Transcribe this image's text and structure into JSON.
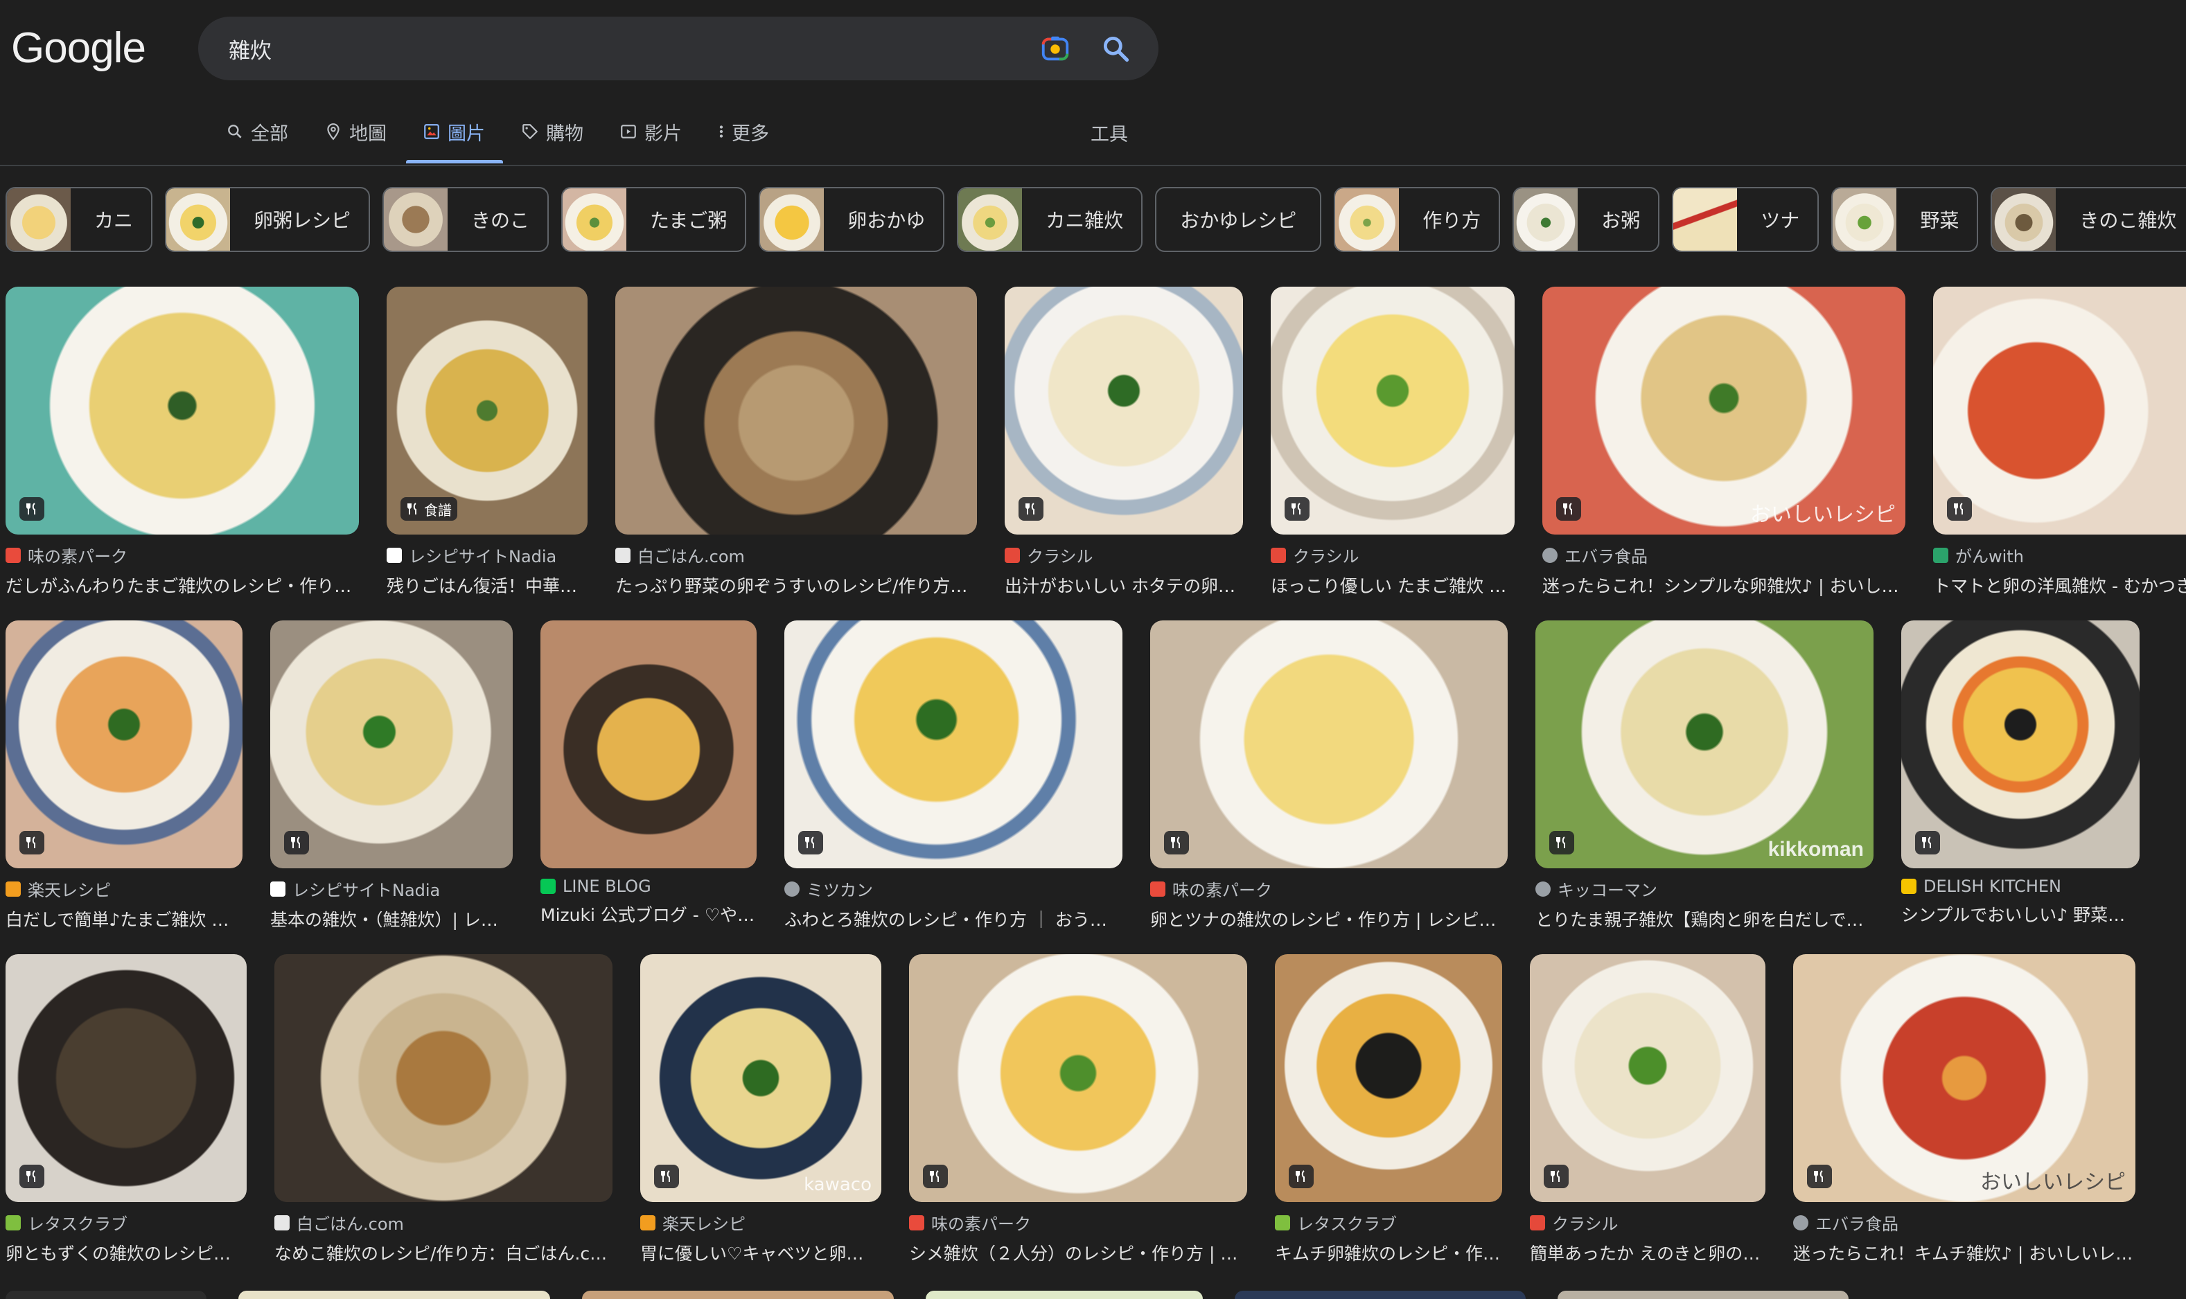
{
  "logo": "Google",
  "search": {
    "query": "雜炊"
  },
  "tabs": [
    {
      "label": "全部",
      "icon": "search-icon"
    },
    {
      "label": "地圖",
      "icon": "map-pin-icon"
    },
    {
      "label": "圖片",
      "icon": "image-icon",
      "active": true
    },
    {
      "label": "購物",
      "icon": "tag-icon"
    },
    {
      "label": "影片",
      "icon": "video-icon"
    },
    {
      "label": "更多",
      "icon": "more-vert-icon"
    }
  ],
  "tools": "工具",
  "chips": [
    "カニ",
    "卵粥レシピ",
    "きのこ",
    "たまご粥",
    "卵おかゆ",
    "カニ雑炊",
    "おかゆレシピ",
    "作り方",
    "お粥",
    "ツナ",
    "野菜",
    "きのこ雑炊"
  ],
  "results": {
    "row1": [
      {
        "source": "味の素パーク",
        "title": "だしがふんわりたまご雑炊のレシピ・作り…"
      },
      {
        "source": "レシピサイトNadia",
        "title": "残りごはん復活！中華…",
        "badge_text": "食譜"
      },
      {
        "source": "白ごはん.com",
        "title": "たっぷり野菜の卵ぞうすいのレシピ/作り方…"
      },
      {
        "source": "クラシル",
        "title": "出汁がおいしい ホタテの卵…"
      },
      {
        "source": "クラシル",
        "title": "ほっこり優しい たまご雑炊 …"
      },
      {
        "source": "エバラ食品",
        "title": "迷ったらこれ！シンプルな卵雑炊♪ | おいし…",
        "overlay": "おいしいレシピ"
      },
      {
        "source": "がんwith",
        "title": "トマトと卵の洋風雑炊 - むかつき"
      }
    ],
    "row2": [
      {
        "source": "楽天レシピ",
        "title": "白だしで簡単♪たまご雑炊 レ…"
      },
      {
        "source": "レシピサイトNadia",
        "title": "基本の雑炊・（鮭雑炊）| レ…"
      },
      {
        "source": "LINE BLOG",
        "title": "Mizuki 公式ブログ - ♡や…"
      },
      {
        "source": "ミツカン",
        "title": "ふわとろ雑炊のレシピ・作り方 ｜ おうち…"
      },
      {
        "source": "味の素パーク",
        "title": "卵とツナの雑炊のレシピ・作り方 | レシピ…"
      },
      {
        "source": "キッコーマン",
        "title": "とりたま親子雑炊【鶏肉と卵を白だしで…",
        "overlay": "kikkoman"
      },
      {
        "source": "DELISH KITCHEN",
        "title": "シンプルでおいしい♪ 野菜の…"
      }
    ],
    "row3": [
      {
        "source": "レタスクラブ",
        "title": "卵ともずくの雑炊のレシピ…"
      },
      {
        "source": "白ごはん.com",
        "title": "なめこ雑炊のレシピ/作り方：白ごはん.co…"
      },
      {
        "source": "楽天レシピ",
        "title": "胃に優しい♡キャベツと卵…",
        "overlay": "kawaco"
      },
      {
        "source": "味の素パーク",
        "title": "シメ雑炊（２人分）のレシピ・作り方 | …"
      },
      {
        "source": "レタスクラブ",
        "title": "キムチ卵雑炊のレシピ・作…"
      },
      {
        "source": "クラシル",
        "title": "簡単あったか えのきと卵の…"
      },
      {
        "source": "エバラ食品",
        "title": "迷ったらこれ！キムチ雑炊♪ | おいしいレ…",
        "overlay": "おいしいレシピ"
      }
    ]
  },
  "colors": {
    "background": "#1f1f1f",
    "search_bg": "#303134",
    "active_tab": "#8ab4f8",
    "text": "#e3e3e3",
    "muted": "#bdc1c6"
  }
}
